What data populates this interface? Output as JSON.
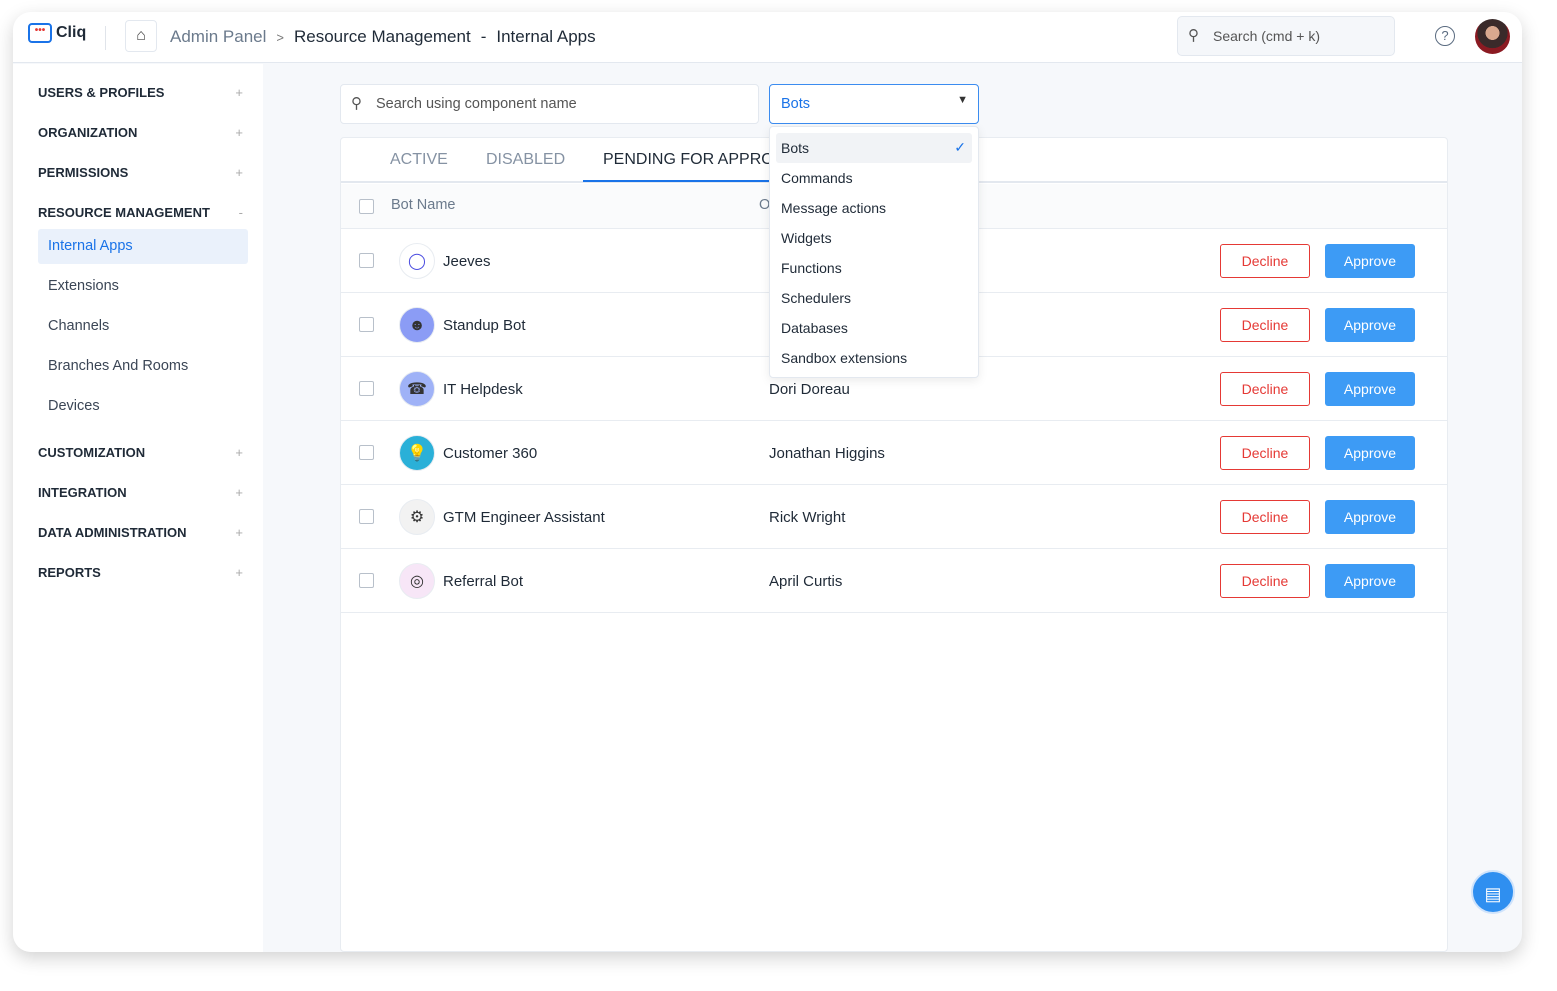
{
  "header": {
    "app_name": "Cliq",
    "breadcrumb": [
      "Admin Panel",
      ">",
      "Resource Management",
      "-",
      "Internal Apps"
    ],
    "search_placeholder": "Search (cmd + k)",
    "help": "?"
  },
  "sidebar": {
    "sections": [
      {
        "label": "USERS & PROFILES",
        "toggle": "+"
      },
      {
        "label": "ORGANIZATION",
        "toggle": "+"
      },
      {
        "label": "PERMISSIONS",
        "toggle": "+"
      },
      {
        "label": "RESOURCE MANAGEMENT",
        "toggle": "-",
        "items": [
          "Internal Apps",
          "Extensions",
          "Channels",
          "Branches And Rooms",
          "Devices"
        ]
      },
      {
        "label": "CUSTOMIZATION",
        "toggle": "+"
      },
      {
        "label": "INTEGRATION",
        "toggle": "+"
      },
      {
        "label": "DATA ADMINISTRATION",
        "toggle": "+"
      },
      {
        "label": "REPORTS",
        "toggle": "+"
      }
    ],
    "active_item": "Internal Apps"
  },
  "filters": {
    "search_placeholder": "Search using component name",
    "type_selected": "Bots",
    "type_options": [
      "Bots",
      "Commands",
      "Message actions",
      "Widgets",
      "Functions",
      "Schedulers",
      "Databases",
      "Sandbox extensions"
    ]
  },
  "tabs": [
    {
      "label": "ACTIVE"
    },
    {
      "label": "DISABLED"
    },
    {
      "label": "PENDING FOR APPROVAL",
      "active": true
    }
  ],
  "table": {
    "columns": [
      "Bot Name",
      "Owner"
    ],
    "decline_label": "Decline",
    "approve_label": "Approve",
    "rows": [
      {
        "name": "Jeeves",
        "owner": "",
        "color": "#ffffff"
      },
      {
        "name": "Standup Bot",
        "owner": "",
        "color": "#8b9cf5"
      },
      {
        "name": "IT Helpdesk",
        "owner": "Dori Doreau",
        "color": "#9fb2f7"
      },
      {
        "name": "Customer 360",
        "owner": "Jonathan Higgins",
        "color": "#2ab0d8"
      },
      {
        "name": "GTM Engineer Assistant",
        "owner": "Rick Wright",
        "color": "#f2f2f2"
      },
      {
        "name": "Referral Bot",
        "owner": "April Curtis",
        "color": "#f7e6f7"
      }
    ]
  },
  "colors": {
    "accent": "#1a73e8",
    "approve": "#3d9bf5",
    "decline": "#e53935"
  }
}
